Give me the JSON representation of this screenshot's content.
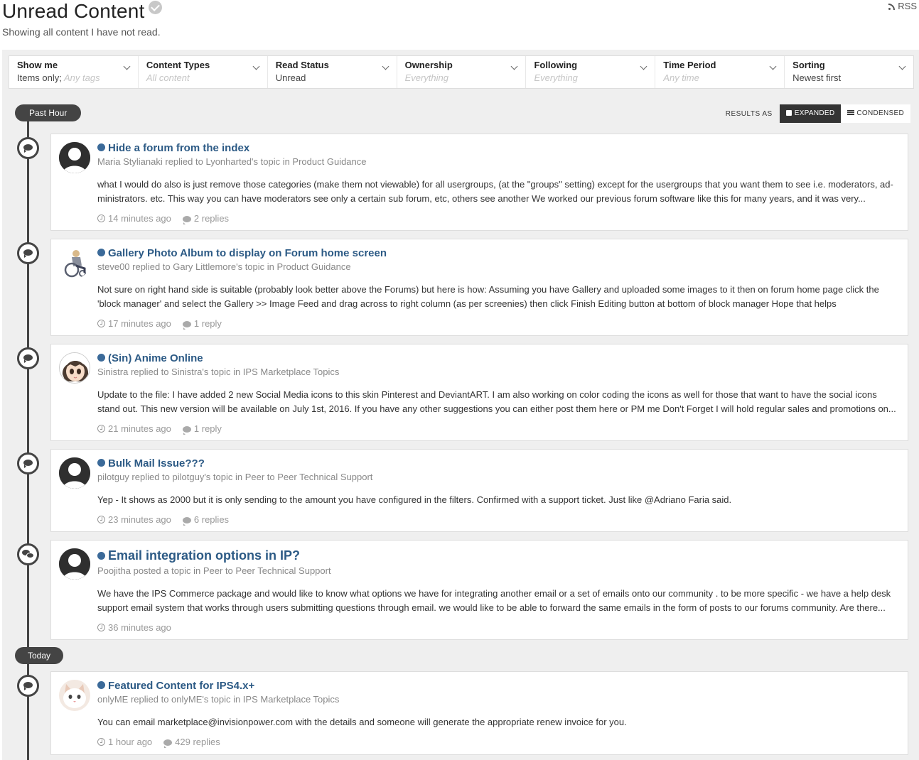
{
  "header": {
    "title": "Unread Content",
    "subtitle": "Showing all content I have not read.",
    "rss_label": "RSS"
  },
  "filters": [
    {
      "title": "Show me",
      "value": "Items only;",
      "value_muted": " Any tags"
    },
    {
      "title": "Content Types",
      "value": "",
      "value_muted": "All content"
    },
    {
      "title": "Read Status",
      "value": "Unread",
      "value_muted": ""
    },
    {
      "title": "Ownership",
      "value": "",
      "value_muted": "Everything"
    },
    {
      "title": "Following",
      "value": "",
      "value_muted": "Everything"
    },
    {
      "title": "Time Period",
      "value": "",
      "value_muted": "Any time"
    },
    {
      "title": "Sorting",
      "value": "Newest first",
      "value_muted": ""
    }
  ],
  "view_toggle": {
    "label": "RESULTS AS",
    "expanded": "EXPANDED",
    "condensed": "CONDENSED",
    "active": "expanded"
  },
  "periods": [
    "Past Hour",
    "Today"
  ],
  "items": [
    {
      "title": "Hide a forum from the index",
      "meta": "Maria Stylianaki replied to Lyonharted's topic in Product Guidance",
      "body": "what I would do also is just remove those categories (make them not viewable) for all usergroups, (at the \"groups\" setting) except for the usergroups that you want them to see i.e. moderators, ad-ministrators. etc. This way you can have moderators see only a certain sub forum, etc, others see another We worked our previous forum software like this for many years, and it was very...",
      "time": "14 minutes ago",
      "replies": "2 replies",
      "avatar": "default-silhouette"
    },
    {
      "title": "Gallery Photo Album to display on Forum home screen",
      "meta": "steve00 replied to Gary Littlemore's topic in Product Guidance",
      "body": "Not sure on right hand side is suitable (probably look better above the Forums) but here is how: Assuming you have Gallery and uploaded some images to it then on forum home page click the 'block manager' and select the Gallery >> Image Feed and drag across to right column (as per screenies) then click Finish Editing button at bottom of block manager Hope that helps",
      "time": "17 minutes ago",
      "replies": "1 reply",
      "avatar": "wheelchair-user"
    },
    {
      "title": "(Sin) Anime Online",
      "meta": "Sinistra replied to Sinistra's topic in IPS Marketplace Topics",
      "body": "Update to the file: I have added 2 new Social Media icons to this skin Pinterest and DeviantART. I am also working on color coding the icons as well for those that want to have the social icons stand out. This new version will be available on July 1st, 2016. If you have any other suggestions you can either post them here or PM me Don't Forget I will hold regular sales and promotions on...",
      "time": "21 minutes ago",
      "replies": "1 reply",
      "avatar": "anime-girl"
    },
    {
      "title": "Bulk Mail Issue???",
      "meta": "pilotguy replied to pilotguy's topic in Peer to Peer Technical Support",
      "body": "Yep - It shows as 2000 but it is only sending to the amount you have configured in the filters. Confirmed with a support ticket. Just like @Adriano Faria said.",
      "time": "23 minutes ago",
      "replies": "6 replies",
      "avatar": "default-silhouette"
    },
    {
      "title": "Email integration options in IP?",
      "meta": "Poojitha posted a topic in Peer to Peer Technical Support",
      "body": "We have the IPS Commerce package and would like to know what options we have for integrating another email or a set of emails onto our community . to be more specific - we have a help desk support email system that works through users submitting questions through email. we would like to be able to forward the same emails in the form of posts to our forums community. Are there...",
      "time": "36 minutes ago",
      "replies": "",
      "avatar": "default-silhouette"
    },
    {
      "title": "Featured Content for IPS4.x+",
      "meta": "onlyME replied to onlyME's topic in IPS Marketplace Topics",
      "body": "You can email marketplace@invisionpower.com with the details and someone will generate the appropriate renew invoice for you.",
      "time": "1 hour ago",
      "replies": "429 replies",
      "avatar": "white-cat"
    }
  ],
  "colors": {
    "accent": "#2c5a85",
    "unread_dot": "#3b6a99",
    "timeline": "#444444",
    "background": "#efefef"
  }
}
